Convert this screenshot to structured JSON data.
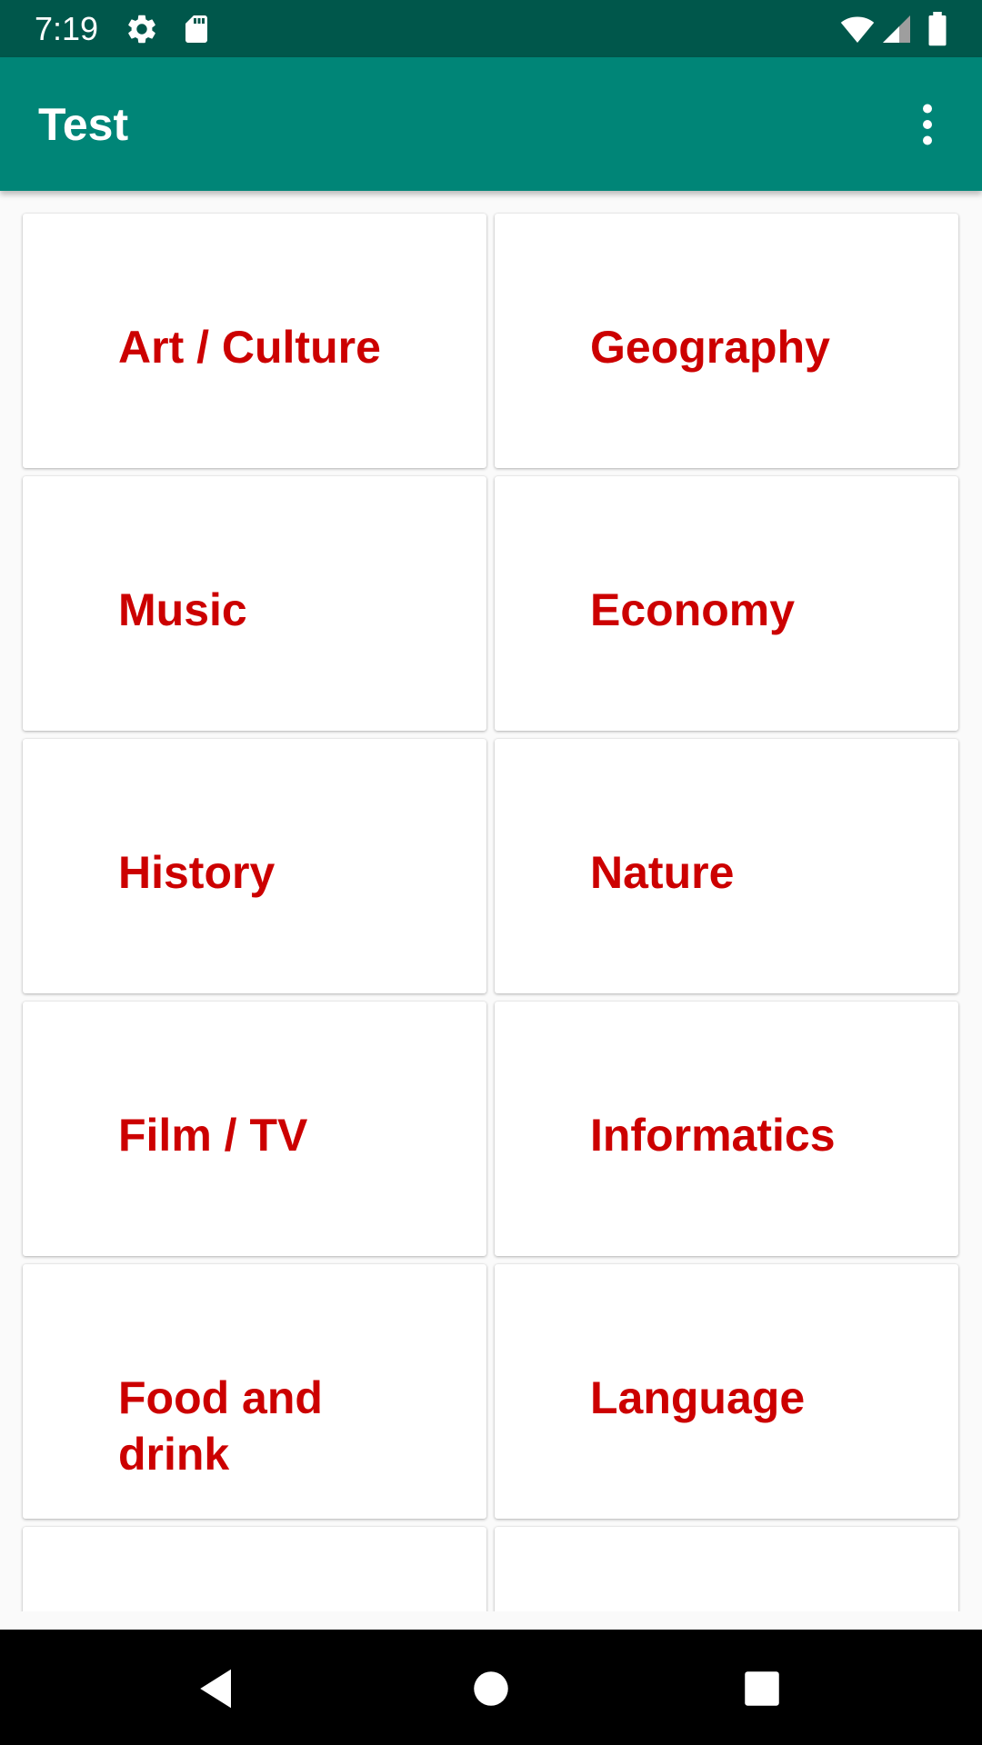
{
  "status_bar": {
    "time": "7:19",
    "icons": [
      "gear-icon",
      "sd-card-icon",
      "wifi-icon",
      "signal-icon",
      "battery-icon"
    ]
  },
  "app_bar": {
    "title": "Test",
    "overflow_icon": "more-vert-icon"
  },
  "categories": [
    {
      "label": "Art / Culture"
    },
    {
      "label": "Geography"
    },
    {
      "label": "Music"
    },
    {
      "label": "Economy"
    },
    {
      "label": "History"
    },
    {
      "label": "Nature"
    },
    {
      "label": "Film / TV"
    },
    {
      "label": "Informatics"
    },
    {
      "label": "Food and drink"
    },
    {
      "label": "Language"
    },
    {
      "label": ""
    },
    {
      "label": ""
    }
  ],
  "nav_bar": {
    "buttons": [
      "back-icon",
      "home-icon",
      "recents-icon"
    ]
  },
  "colors": {
    "status_bar": "#00574b",
    "app_bar": "#008577",
    "label_text": "#cc0000",
    "background": "#fafafa"
  }
}
